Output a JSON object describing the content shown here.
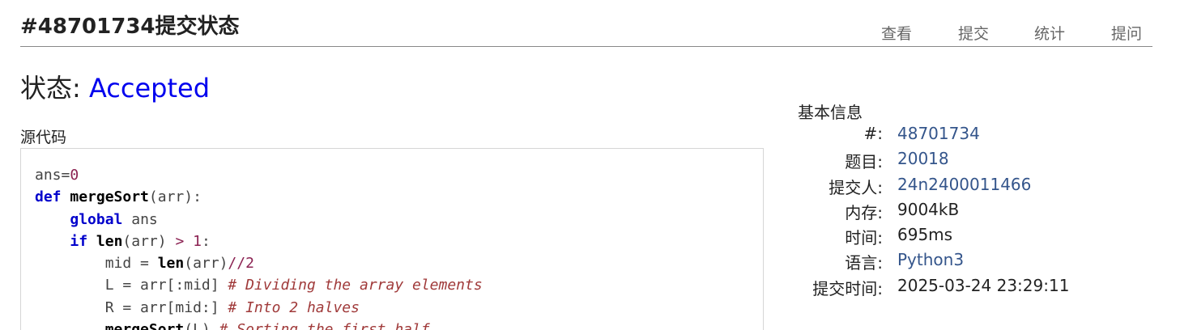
{
  "header": {
    "title": "#48701734提交状态",
    "nav": [
      {
        "label": "查看"
      },
      {
        "label": "提交"
      },
      {
        "label": "统计"
      },
      {
        "label": "提问"
      }
    ]
  },
  "status": {
    "label": "状态:",
    "value": "Accepted",
    "value_color": "#0000ee"
  },
  "source": {
    "label": "源代码",
    "lines": [
      "ans=0",
      "def mergeSort(arr):",
      "    global ans",
      "    if len(arr) > 1:",
      "        mid = len(arr)//2",
      "        L = arr[:mid] # Dividing the array elements",
      "        R = arr[mid:] # Into 2 halves",
      "        mergeSort(L) # Sorting the first half"
    ]
  },
  "info": {
    "title": "基本信息",
    "rows": [
      {
        "key": "#:",
        "value": "48701734",
        "link": true
      },
      {
        "key": "题目:",
        "value": "20018",
        "link": true
      },
      {
        "key": "提交人:",
        "value": "24n2400011466",
        "link": true
      },
      {
        "key": "内存:",
        "value": "9004kB",
        "link": false
      },
      {
        "key": "时间:",
        "value": "695ms",
        "link": false
      },
      {
        "key": "语言:",
        "value": "Python3",
        "link": true
      },
      {
        "key": "提交时间:",
        "value": "2025-03-24 23:29:11",
        "link": false
      }
    ],
    "link_color": "#34558b"
  }
}
